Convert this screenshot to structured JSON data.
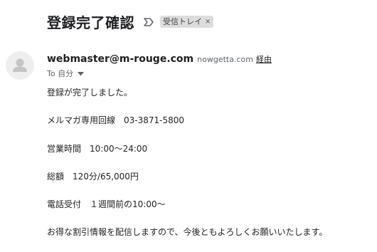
{
  "email": {
    "subject": "登録完了確認",
    "label": "受信トレイ",
    "label_remove": "×",
    "sender": {
      "address": "webmaster@m-rouge.com",
      "domain": "nowgetta.com",
      "via": "経由"
    },
    "recipient": "To 自分",
    "body": {
      "line1": "登録が完了しました。",
      "line2": "メルマガ専用回線　03-3871-5800",
      "line3": "営業時間　10:00～24:00",
      "line4": "総額　120分/65,000円",
      "line5": "電話受付　１週間前の10:00～",
      "line6": "お得な割引情報を配信しますので、今後ともよろしくお願いいたします。"
    }
  },
  "icons": {
    "importance": "importance-marker-icon",
    "avatar": "default-avatar-icon",
    "caret": "chevron-down-icon"
  },
  "colors": {
    "label_chip_bg": "#dddddd",
    "avatar_bg": "#eeeeee",
    "avatar_figure": "#c4c4c4"
  }
}
